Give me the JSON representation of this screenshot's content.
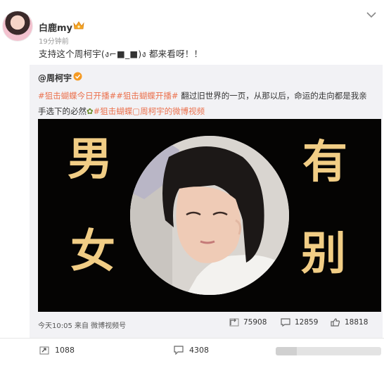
{
  "author": {
    "name": "白鹿my",
    "time": "19分钟前",
    "text": "支持这个周柯宇(ง⌐■_■)ง 都来看呀！！"
  },
  "repost": {
    "author": "@周柯宇",
    "tag1": "#狙击蝴蝶今日开播#",
    "tag2": "#狙击蝴蝶开播#",
    "text1": " 翻过旧世界的一页，从那以后，命运的走向都是我亲手选下的必然",
    "tag3": "#狙击蝴蝶",
    "link": "▢周柯宇的微博视频",
    "video_chars": [
      "男",
      "女",
      "有",
      "别"
    ],
    "meta": "今天10:05 来自 微博视频号",
    "stats": {
      "reposts": "75908",
      "comments": "12859",
      "likes": "18818"
    }
  },
  "actions": {
    "reposts": "1088",
    "comments": "4308"
  },
  "colors": {
    "tag": "#eb7350",
    "video_text": "#f1cd85",
    "video_bg": "#050403"
  }
}
